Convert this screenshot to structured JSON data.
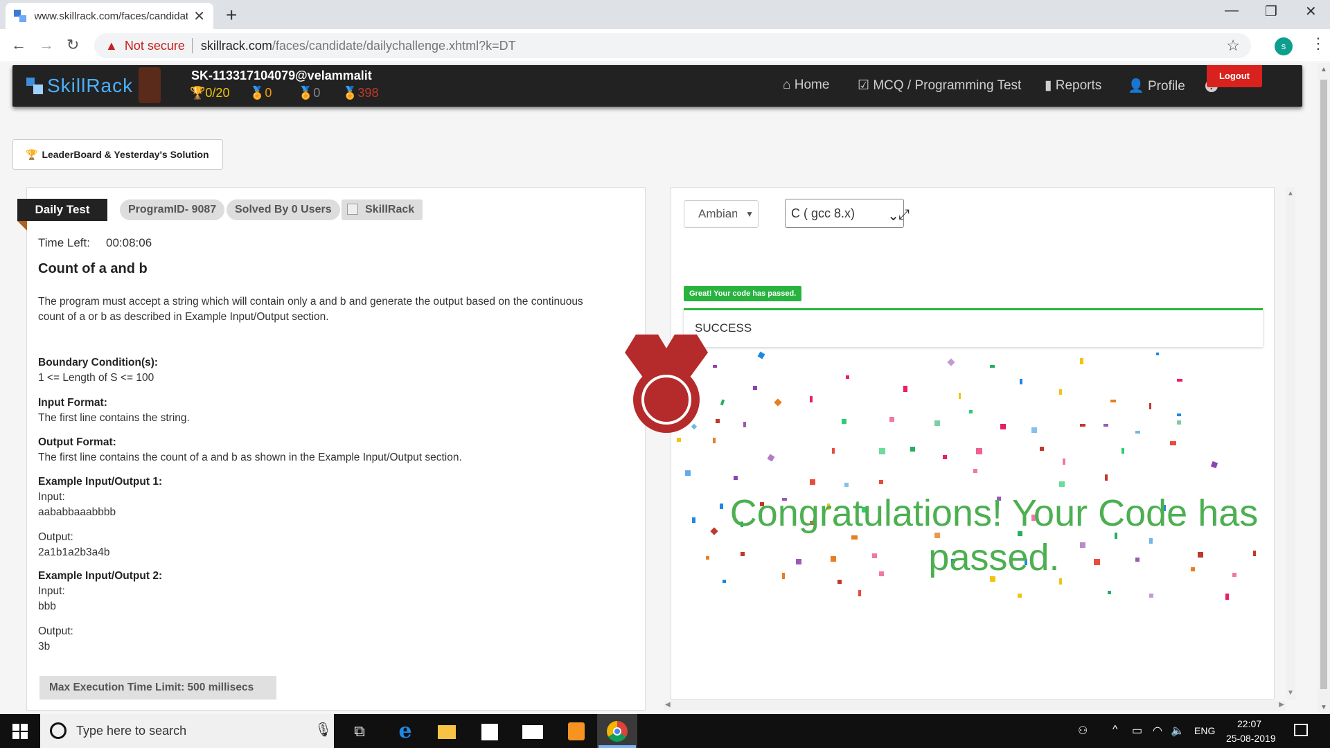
{
  "browser": {
    "tab_title": "www.skillrack.com/faces/candidate",
    "tab_close": "✕",
    "new_tab": "+",
    "min": "—",
    "max": "❐",
    "close": "✕",
    "not_secure": "Not secure",
    "url_host": "skillrack.com",
    "url_path": "/faces/candidate/dailychallenge.xhtml?k=DT",
    "profile_initial": "s"
  },
  "header": {
    "logo": "SkillRack",
    "user_id": "SK-113317104079@velammalit",
    "stats": {
      "trophy": "0/20",
      "gold": "0",
      "silver": "0",
      "bronze": "398"
    },
    "nav": {
      "home": "Home",
      "mcq": "MCQ / Programming Test",
      "reports": "Reports",
      "profile": "Profile",
      "help": "?"
    },
    "logout": "Logout"
  },
  "leaderboard_button": "LeaderBoard & Yesterday's Solution",
  "problem": {
    "badge": "Daily Test",
    "program_id": "ProgramID- 9087",
    "solved_by": "Solved By 0 Users",
    "source": "SkillRack",
    "time_left_label": "Time Left:",
    "time_left": "00:08:06",
    "title": "Count of a and b",
    "description": "The program must accept a string which will contain only a and b and generate the output based on the continuous count of a or b as described in Example Input/Output section.",
    "boundary_h": "Boundary Condition(s):",
    "boundary_t": "1 <= Length of S <= 100",
    "input_h": "Input Format:",
    "input_t": "The first line contains the string.",
    "output_h": "Output Format:",
    "output_t": "The first line contains the count of a and b as shown in the Example Input/Output section.",
    "ex1_h": "Example Input/Output 1:",
    "ex1_in_label": "Input:",
    "ex1_in": "aababbaaabbbb",
    "ex1_out_label": "Output:",
    "ex1_out": "2a1b1a2b3a4b",
    "ex2_h": "Example Input/Output 2:",
    "ex2_in_label": "Input:",
    "ex2_in": "bbb",
    "ex2_out_label": "Output:",
    "ex2_out": "3b",
    "exec_limit": "Max Execution Time Limit: 500 millisecs"
  },
  "editor": {
    "theme": "Ambiance",
    "language": "C ( gcc 8.x)",
    "passed_badge": "Great! Your code has passed.",
    "result": "SUCCESS",
    "congrats": "Congratulations! Your Code has passed."
  },
  "taskbar": {
    "search_placeholder": "Type here to search",
    "lang": "ENG",
    "time": "22:07",
    "date": "25-08-2019"
  },
  "colors": {
    "success_green": "#28b33e",
    "congrats_green": "#4caf50",
    "logout_red": "#d9221d",
    "nav_bg": "#222222",
    "medal_red": "#b52a2a"
  }
}
